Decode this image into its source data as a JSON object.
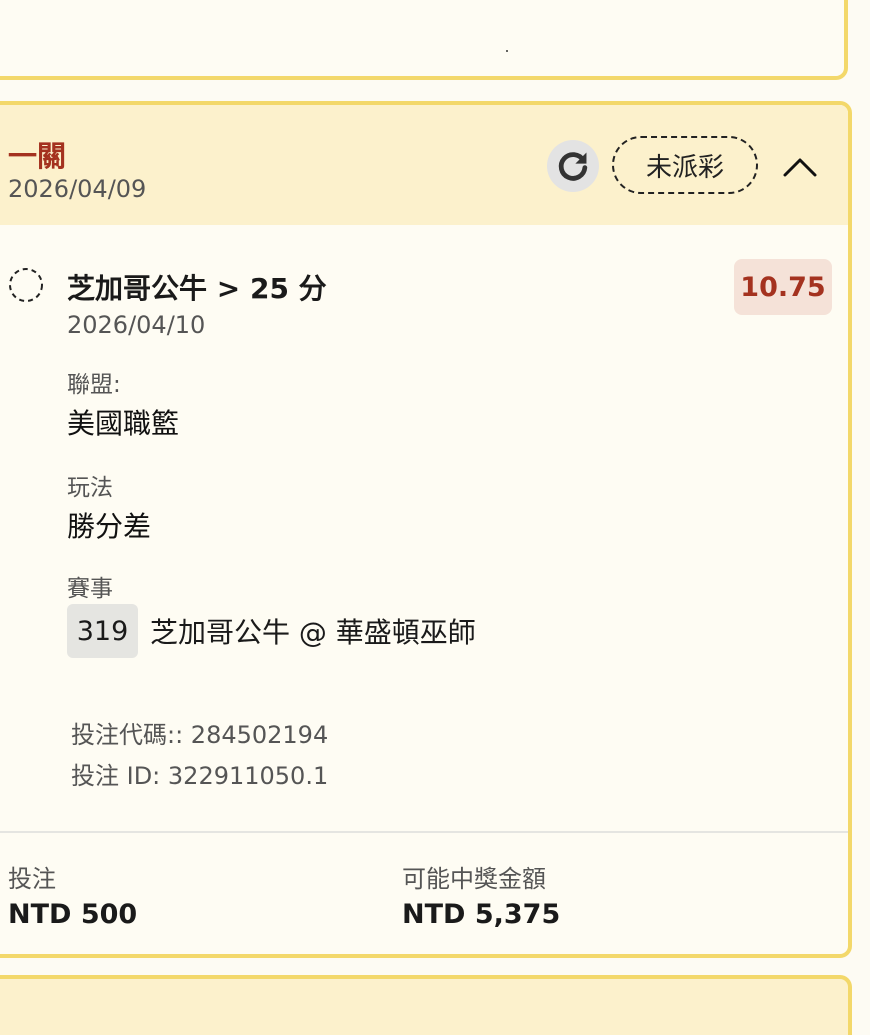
{
  "bet": {
    "type": "一關",
    "date": "2026/04/09",
    "status": "未派彩",
    "leg": {
      "selection": "芝加哥公牛 > 25 分",
      "odds": "10.75",
      "date": "2026/04/10",
      "league_label": "聯盟:",
      "league": "美國職籃",
      "market_label": "玩法",
      "market": "勝分差",
      "event_label": "賽事",
      "event_number": "319",
      "event_name": "芝加哥公牛 @ 華盛頓巫師",
      "bet_code": "投注代碼:: 284502194",
      "bet_id": "投注 ID: 322911050.1"
    },
    "footer": {
      "stake_label": "投注",
      "stake": "NTD 500",
      "payout_label": "可能中獎金額",
      "payout": "NTD 5,375"
    }
  },
  "icons": {
    "refresh": "refresh-icon",
    "collapse": "chevron-up-icon",
    "leg_status": "pending-dashed-circle-icon"
  },
  "colors": {
    "accent_red": "#a4321f",
    "card_border": "#f3d86a",
    "header_bg": "#fcf1cc"
  }
}
